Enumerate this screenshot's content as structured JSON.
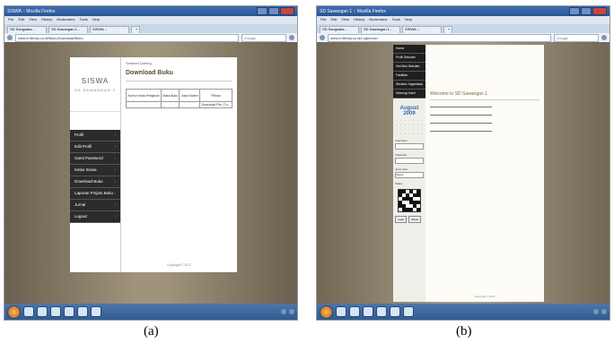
{
  "screenshot_a": {
    "window_title": "SISWA :: Mozilla Firefox",
    "menu": [
      "File",
      "Edit",
      "View",
      "History",
      "Bookmarks",
      "Tools",
      "Help"
    ],
    "tabs": [
      "SD Sangsaka...",
      "SD Sawangan 1...",
      "SISWA :: ",
      "+"
    ],
    "url": "www.e-library.co.id/Buku/Download/Buku",
    "search_placeholder": "Google",
    "site": {
      "brand_title": "SISWA",
      "brand_subtitle": "SD SAWANGAN 1",
      "menu": [
        "Profil",
        "Edit Profil",
        "Ganti Password",
        "Kelas Siswa",
        "Download Buku",
        "Laporan Pinjam Buku",
        "Jurnal",
        "Logout"
      ],
      "breadcrumb": "Selamat Datang",
      "page_title": "Download Buku",
      "table_headers": [
        "Nomor Mata Pelajaran",
        "Mata Buku",
        "Judul Materi",
        "Pilihan"
      ],
      "table_row": [
        "",
        "",
        "",
        "Download File | Tu..."
      ],
      "copyright": "Copyright © 2017"
    },
    "caption": "(a)"
  },
  "screenshot_b": {
    "window_title": "SD Sawangan 1 :: Mozilla Firefox",
    "menu": [
      "File",
      "Edit",
      "View",
      "History",
      "Bookmarks",
      "Tools",
      "Help"
    ],
    "tabs": [
      "SD Sangsaka...",
      "SD Sawangan 1...",
      "SISWA :: ",
      "+"
    ],
    "url": "www.e-library.co.id/Login/user",
    "search_placeholder": "Google",
    "site": {
      "menu": [
        "Home",
        "Profil Sekolah",
        "Visi Misi Sekolah",
        "Fasilitas",
        "Struktur Organisasi",
        "Hubungi Kami"
      ],
      "calendar_month": "August",
      "calendar_year": "2009",
      "welcome_title": "Welcome to SD Sawangan 1",
      "form_labels": [
        "Username",
        "Password",
        "Jenis User",
        "Status"
      ],
      "select_value": "Siswa",
      "buttons": [
        "Login",
        "Reset"
      ],
      "copyright": "Copyright © 2017"
    },
    "caption": "(b)"
  }
}
